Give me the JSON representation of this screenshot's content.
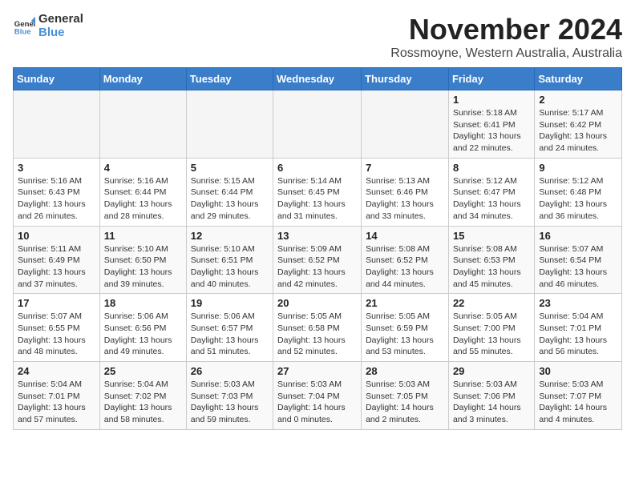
{
  "logo": {
    "general": "General",
    "blue": "Blue"
  },
  "header": {
    "month": "November 2024",
    "location": "Rossmoyne, Western Australia, Australia"
  },
  "days_of_week": [
    "Sunday",
    "Monday",
    "Tuesday",
    "Wednesday",
    "Thursday",
    "Friday",
    "Saturday"
  ],
  "weeks": [
    [
      {
        "day": "",
        "info": ""
      },
      {
        "day": "",
        "info": ""
      },
      {
        "day": "",
        "info": ""
      },
      {
        "day": "",
        "info": ""
      },
      {
        "day": "",
        "info": ""
      },
      {
        "day": "1",
        "info": "Sunrise: 5:18 AM\nSunset: 6:41 PM\nDaylight: 13 hours\nand 22 minutes."
      },
      {
        "day": "2",
        "info": "Sunrise: 5:17 AM\nSunset: 6:42 PM\nDaylight: 13 hours\nand 24 minutes."
      }
    ],
    [
      {
        "day": "3",
        "info": "Sunrise: 5:16 AM\nSunset: 6:43 PM\nDaylight: 13 hours\nand 26 minutes."
      },
      {
        "day": "4",
        "info": "Sunrise: 5:16 AM\nSunset: 6:44 PM\nDaylight: 13 hours\nand 28 minutes."
      },
      {
        "day": "5",
        "info": "Sunrise: 5:15 AM\nSunset: 6:44 PM\nDaylight: 13 hours\nand 29 minutes."
      },
      {
        "day": "6",
        "info": "Sunrise: 5:14 AM\nSunset: 6:45 PM\nDaylight: 13 hours\nand 31 minutes."
      },
      {
        "day": "7",
        "info": "Sunrise: 5:13 AM\nSunset: 6:46 PM\nDaylight: 13 hours\nand 33 minutes."
      },
      {
        "day": "8",
        "info": "Sunrise: 5:12 AM\nSunset: 6:47 PM\nDaylight: 13 hours\nand 34 minutes."
      },
      {
        "day": "9",
        "info": "Sunrise: 5:12 AM\nSunset: 6:48 PM\nDaylight: 13 hours\nand 36 minutes."
      }
    ],
    [
      {
        "day": "10",
        "info": "Sunrise: 5:11 AM\nSunset: 6:49 PM\nDaylight: 13 hours\nand 37 minutes."
      },
      {
        "day": "11",
        "info": "Sunrise: 5:10 AM\nSunset: 6:50 PM\nDaylight: 13 hours\nand 39 minutes."
      },
      {
        "day": "12",
        "info": "Sunrise: 5:10 AM\nSunset: 6:51 PM\nDaylight: 13 hours\nand 40 minutes."
      },
      {
        "day": "13",
        "info": "Sunrise: 5:09 AM\nSunset: 6:52 PM\nDaylight: 13 hours\nand 42 minutes."
      },
      {
        "day": "14",
        "info": "Sunrise: 5:08 AM\nSunset: 6:52 PM\nDaylight: 13 hours\nand 44 minutes."
      },
      {
        "day": "15",
        "info": "Sunrise: 5:08 AM\nSunset: 6:53 PM\nDaylight: 13 hours\nand 45 minutes."
      },
      {
        "day": "16",
        "info": "Sunrise: 5:07 AM\nSunset: 6:54 PM\nDaylight: 13 hours\nand 46 minutes."
      }
    ],
    [
      {
        "day": "17",
        "info": "Sunrise: 5:07 AM\nSunset: 6:55 PM\nDaylight: 13 hours\nand 48 minutes."
      },
      {
        "day": "18",
        "info": "Sunrise: 5:06 AM\nSunset: 6:56 PM\nDaylight: 13 hours\nand 49 minutes."
      },
      {
        "day": "19",
        "info": "Sunrise: 5:06 AM\nSunset: 6:57 PM\nDaylight: 13 hours\nand 51 minutes."
      },
      {
        "day": "20",
        "info": "Sunrise: 5:05 AM\nSunset: 6:58 PM\nDaylight: 13 hours\nand 52 minutes."
      },
      {
        "day": "21",
        "info": "Sunrise: 5:05 AM\nSunset: 6:59 PM\nDaylight: 13 hours\nand 53 minutes."
      },
      {
        "day": "22",
        "info": "Sunrise: 5:05 AM\nSunset: 7:00 PM\nDaylight: 13 hours\nand 55 minutes."
      },
      {
        "day": "23",
        "info": "Sunrise: 5:04 AM\nSunset: 7:01 PM\nDaylight: 13 hours\nand 56 minutes."
      }
    ],
    [
      {
        "day": "24",
        "info": "Sunrise: 5:04 AM\nSunset: 7:01 PM\nDaylight: 13 hours\nand 57 minutes."
      },
      {
        "day": "25",
        "info": "Sunrise: 5:04 AM\nSunset: 7:02 PM\nDaylight: 13 hours\nand 58 minutes."
      },
      {
        "day": "26",
        "info": "Sunrise: 5:03 AM\nSunset: 7:03 PM\nDaylight: 13 hours\nand 59 minutes."
      },
      {
        "day": "27",
        "info": "Sunrise: 5:03 AM\nSunset: 7:04 PM\nDaylight: 14 hours\nand 0 minutes."
      },
      {
        "day": "28",
        "info": "Sunrise: 5:03 AM\nSunset: 7:05 PM\nDaylight: 14 hours\nand 2 minutes."
      },
      {
        "day": "29",
        "info": "Sunrise: 5:03 AM\nSunset: 7:06 PM\nDaylight: 14 hours\nand 3 minutes."
      },
      {
        "day": "30",
        "info": "Sunrise: 5:03 AM\nSunset: 7:07 PM\nDaylight: 14 hours\nand 4 minutes."
      }
    ]
  ]
}
